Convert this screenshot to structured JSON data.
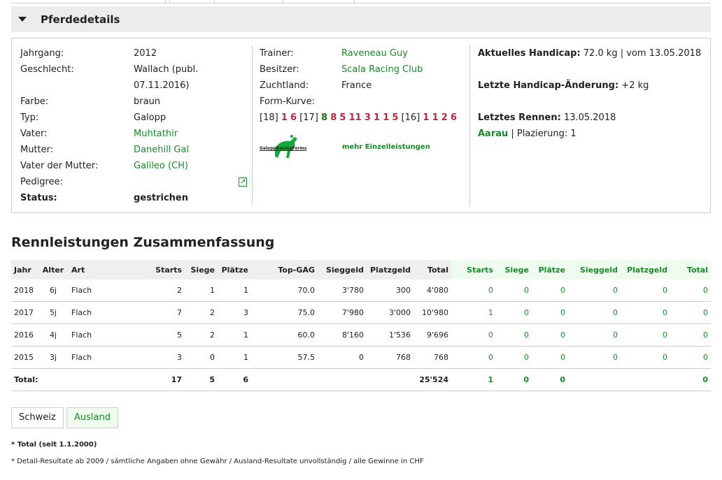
{
  "section_title": "Pferdedetails",
  "details": {
    "col1": [
      {
        "label": "Jahrgang:",
        "value": "2012"
      },
      {
        "label": "Geschlecht:",
        "value": "Wallach (publ. 07.11.2016)"
      },
      {
        "label": "Farbe:",
        "value": "braun"
      },
      {
        "label": "Typ:",
        "value": "Galopp"
      },
      {
        "label": "Vater:",
        "value": "Muhtathir",
        "link": true
      },
      {
        "label": "Mutter:",
        "value": "Danehill Gal",
        "link": true
      },
      {
        "label": "Vater der Mutter:",
        "value": "Galileo (CH)",
        "link": true
      },
      {
        "label": "Pedigree:",
        "value": ""
      },
      {
        "label": "Status:",
        "value": "gestrichen",
        "bold": true
      }
    ],
    "col2": [
      {
        "label": "Trainer:",
        "value": "Raveneau Guy",
        "link": true
      },
      {
        "label": "Besitzer:",
        "value": "Scala Racing Club",
        "link": true
      },
      {
        "label": "Zuchtland:",
        "value": "France"
      }
    ],
    "form_label": "Form-Kurve:",
    "form": [
      [
        "[18]",
        "b"
      ],
      [
        "1",
        "r"
      ],
      [
        "6",
        "r"
      ],
      [
        "[17]",
        "b"
      ],
      [
        "8",
        "g"
      ],
      [
        "8",
        "r"
      ],
      [
        "5",
        "r"
      ],
      [
        "11",
        "r"
      ],
      [
        "3",
        "r"
      ],
      [
        "1",
        "r"
      ],
      [
        "1",
        "r"
      ],
      [
        "5",
        "r"
      ],
      [
        "[16]",
        "b"
      ],
      [
        "1",
        "r"
      ],
      [
        "1",
        "r"
      ],
      [
        "2",
        "r"
      ],
      [
        "6",
        "r"
      ]
    ],
    "logo_text": "GaloppRacingForms",
    "more_link": "mehr Einzelleistungen",
    "col3": {
      "handicap_label": "Aktuelles Handicap:",
      "handicap_value": "72.0 kg | vom 13.05.2018",
      "change_label": "Letzte Handicap-Änderung:",
      "change_value": "+2 kg",
      "last_race_label": "Letztes Rennen:",
      "last_race_date": "13.05.2018",
      "last_race_place": "Aarau",
      "placing": "| Plazierung: 1"
    }
  },
  "summary_title": "Rennleistungen Zusammenfassung",
  "table": {
    "headers": [
      "Jahr",
      "Alter",
      "Art",
      "Starts",
      "Siege",
      "Plätze",
      "Top-GAG",
      "Sieggeld",
      "Platzgeld",
      "Total",
      "Starts",
      "Siege",
      "Plätze",
      "Sieggeld",
      "Platzgeld",
      "Total"
    ],
    "rows": [
      [
        "2018",
        "6j",
        "Flach",
        "2",
        "1",
        "1",
        "70.0",
        "3'780",
        "300",
        "4'080",
        "0",
        "0",
        "0",
        "0",
        "0",
        "0"
      ],
      [
        "2017",
        "5j",
        "Flach",
        "7",
        "2",
        "3",
        "75.0",
        "7'980",
        "3'000",
        "10'980",
        "1",
        "0",
        "0",
        "0",
        "0",
        "0"
      ],
      [
        "2016",
        "4j",
        "Flach",
        "5",
        "2",
        "1",
        "60.0",
        "8'160",
        "1'536",
        "9'696",
        "0",
        "0",
        "0",
        "0",
        "0",
        "0"
      ],
      [
        "2015",
        "3j",
        "Flach",
        "3",
        "0",
        "1",
        "57.5",
        "0",
        "768",
        "768",
        "0",
        "0",
        "0",
        "0",
        "0",
        "0"
      ]
    ],
    "total": [
      "Total:",
      "",
      "",
      "17",
      "5",
      "6",
      "",
      "",
      "",
      "25'524",
      "1",
      "0",
      "0",
      "",
      "",
      "0"
    ]
  },
  "buttons": {
    "schweiz": "Schweiz",
    "ausland": "Ausland"
  },
  "footnotes": [
    "* Total (seit 1.1.2000)",
    "* Detail-Resultate ab 2009 / sämtliche Angaben ohne Gewähr / Ausland-Resultate unvollständig / alle Gewinne in CHF"
  ]
}
